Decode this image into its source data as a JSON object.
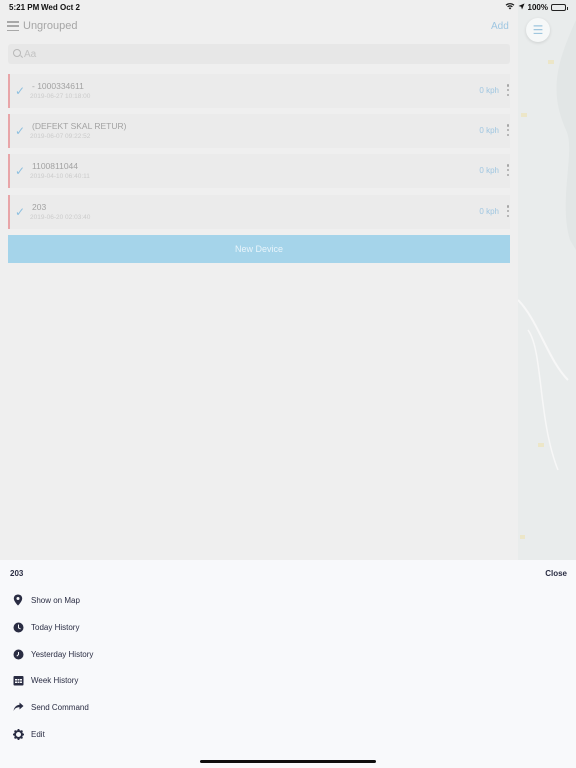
{
  "status_bar": {
    "time": "5:21 PM",
    "date": "Wed Oct 2",
    "battery": "100%"
  },
  "header": {
    "group_title": "Ungrouped",
    "add_label": "Add"
  },
  "search": {
    "placeholder": "Aa"
  },
  "devices": [
    {
      "name": "- 1000334611",
      "timestamp": "2019-06-27 10:18:00",
      "speed": "0 kph"
    },
    {
      "name": "(DEFEKT SKAL RETUR)",
      "timestamp": "2019-06-07 09:22:52",
      "speed": "0 kph"
    },
    {
      "name": "1100811044",
      "timestamp": "2019-04-10 06:40:11",
      "speed": "0 kph"
    },
    {
      "name": "203",
      "timestamp": "2019-06-20 02:03:40",
      "speed": "0 kph"
    }
  ],
  "new_device_label": "New Device",
  "sheet": {
    "title": "203",
    "close_label": "Close",
    "actions": [
      {
        "label": "Show on Map",
        "icon": "map-pin-icon"
      },
      {
        "label": "Today History",
        "icon": "clock-icon"
      },
      {
        "label": "Yesterday History",
        "icon": "history-icon"
      },
      {
        "label": "Week History",
        "icon": "calendar-icon"
      },
      {
        "label": "Send Command",
        "icon": "share-arrow-icon"
      },
      {
        "label": "Edit",
        "icon": "gear-icon"
      }
    ]
  },
  "colors": {
    "accent": "#9fc6e1",
    "status_bar_red": "#e8a5a8",
    "new_device_button": "#a5d4ea",
    "sheet_text": "#2a2d43"
  }
}
